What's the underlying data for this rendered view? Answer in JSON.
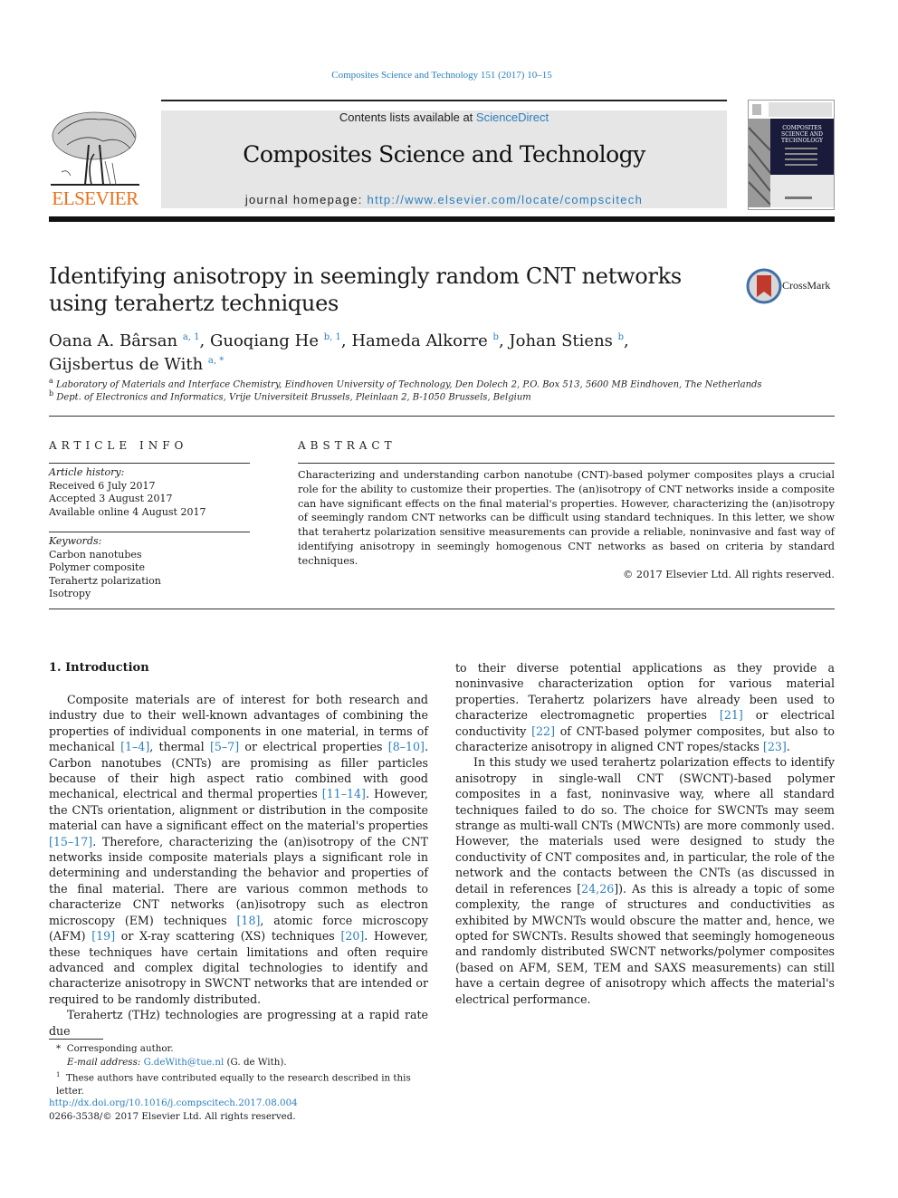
{
  "journal_ref": "Composites Science and Technology 151 (2017) 10–15",
  "header": {
    "publisher_logo_text": "ELSEVIER",
    "contents_prefix": "Contents lists available at ",
    "contents_link": "ScienceDirect",
    "journal_title": "Composites Science and Technology",
    "homepage_prefix": "journal homepage: ",
    "homepage_link": "http://www.elsevier.com/locate/compscitech",
    "cover_title": "COMPOSITES SCIENCE AND TECHNOLOGY"
  },
  "article": {
    "title": "Identifying anisotropy in seemingly random CNT networks using terahertz techniques",
    "crossmark_label": "CrossMark",
    "authors": [
      {
        "name": "Oana A. Bârsan",
        "sup": "a, 1",
        "sep": ", "
      },
      {
        "name": "Guoqiang He",
        "sup": "b, 1",
        "sep": ", "
      },
      {
        "name": "Hameda Alkorre",
        "sup": "b",
        "sep": ", "
      },
      {
        "name": "Johan Stiens",
        "sup": "b",
        "sep": ","
      },
      {
        "name": "Gijsbertus de With",
        "sup": "a, *",
        "sep": ""
      }
    ],
    "affiliations": [
      {
        "key": "a",
        "text": "Laboratory of Materials and Interface Chemistry, Eindhoven University of Technology, Den Dolech 2, P.O. Box 513, 5600 MB Eindhoven, The Netherlands"
      },
      {
        "key": "b",
        "text": "Dept. of Electronics and Informatics, Vrije Universiteit Brussels, Pleinlaan 2, B-1050 Brussels, Belgium"
      }
    ]
  },
  "article_info": {
    "heading": "ARTICLE INFO",
    "history_label": "Article history:",
    "history": [
      "Received 6 July 2017",
      "Accepted 3 August 2017",
      "Available online 4 August 2017"
    ],
    "keywords_label": "Keywords:",
    "keywords": [
      "Carbon nanotubes",
      "Polymer composite",
      "Terahertz polarization",
      "Isotropy"
    ]
  },
  "abstract": {
    "heading": "ABSTRACT",
    "text": "Characterizing and understanding carbon nanotube (CNT)-based polymer composites plays a crucial role for the ability to customize their properties. The (an)isotropy of CNT networks inside a composite can have significant effects on the final material's properties. However, characterizing the (an)isotropy of seemingly random CNT networks can be difficult using standard techniques. In this letter, we show that terahertz polarization sensitive measurements can provide a reliable, noninvasive and fast way of identifying anisotropy in seemingly homogenous CNT networks as based on criteria by standard techniques.",
    "copyright": "© 2017 Elsevier Ltd. All rights reserved."
  },
  "body": {
    "section_heading": "1.  Introduction",
    "left_paragraphs": [
      [
        {
          "t": "Composite materials are of interest for both research and industry due to their well-known advantages of combining the properties of individual components in one material, in terms of mechanical "
        },
        {
          "ref": "[1–4]"
        },
        {
          "t": ", thermal "
        },
        {
          "ref": "[5–7]"
        },
        {
          "t": " or electrical properties "
        },
        {
          "ref": "[8–10]"
        },
        {
          "t": ". Carbon nanotubes (CNTs) are promising as filler particles because of their high aspect ratio combined with good mechanical, electrical and thermal properties "
        },
        {
          "ref": "[11–14]"
        },
        {
          "t": ". However, the CNTs orientation, alignment or distribution in the composite material can have a significant effect on the material's properties "
        },
        {
          "ref": "[15–17]"
        },
        {
          "t": ". Therefore, characterizing the (an)isotropy of the CNT networks inside composite materials plays a significant role in determining and understanding the behavior and properties of the final material. There are various common methods to characterize CNT networks (an)isotropy such as electron microscopy (EM) techniques "
        },
        {
          "ref": "[18]"
        },
        {
          "t": ", atomic force microscopy (AFM) "
        },
        {
          "ref": "[19]"
        },
        {
          "t": " or X-ray scattering (XS) techniques "
        },
        {
          "ref": "[20]"
        },
        {
          "t": ". However, these techniques have certain limitations and often require advanced and complex digital technologies to identify and characterize anisotropy in SWCNT networks that are intended or required to be randomly distributed."
        }
      ],
      [
        {
          "t": "Terahertz (THz) technologies are progressing at a rapid rate due"
        }
      ]
    ],
    "right_paragraphs": [
      [
        {
          "t": "to their diverse potential applications as they provide a noninvasive characterization option for various material properties. Terahertz polarizers have already been used to characterize electromagnetic properties "
        },
        {
          "ref": "[21]"
        },
        {
          "t": " or electrical conductivity "
        },
        {
          "ref": "[22]"
        },
        {
          "t": " of CNT-based polymer composites, but also to characterize anisotropy in aligned CNT ropes/stacks "
        },
        {
          "ref": "[23]"
        },
        {
          "t": "."
        }
      ],
      [
        {
          "t": "In this study we used terahertz polarization effects to identify anisotropy in single-wall CNT (SWCNT)-based polymer composites in a fast, noninvasive way, where all standard techniques failed to do so. The choice for SWCNTs may seem strange as multi-wall CNTs (MWCNTs) are more commonly used. However, the materials used were designed to study the conductivity of CNT composites and, in particular, the role of the network and the contacts between the CNTs (as discussed in detail in references ["
        },
        {
          "ref": "24,26"
        },
        {
          "t": "]). As this is already a topic of some complexity, the range of structures and conductivities as exhibited by MWCNTs would obscure the matter and, hence, we opted for SWCNTs. Results showed that seemingly homogeneous and randomly distributed SWCNT networks/polymer composites (based on AFM, SEM, TEM and SAXS measurements) can still have a certain degree of anisotropy which affects the material's electrical performance."
        }
      ]
    ]
  },
  "footnotes": {
    "corresponding_mark": "*",
    "corresponding": "Corresponding author.",
    "email_label": "E-mail address: ",
    "email": "G.deWith@tue.nl",
    "email_suffix": " (G. de With).",
    "equal_mark": "1",
    "equal": "These authors have contributed equally to the research described in this letter.",
    "doi": "http://dx.doi.org/10.1016/j.compscitech.2017.08.004",
    "issn": "0266-3538/© 2017 Elsevier Ltd. All rights reserved."
  },
  "colors": {
    "link": "#2a7fbf",
    "elsevier_orange": "#e9711c",
    "header_gray": "#e6e6e6"
  }
}
